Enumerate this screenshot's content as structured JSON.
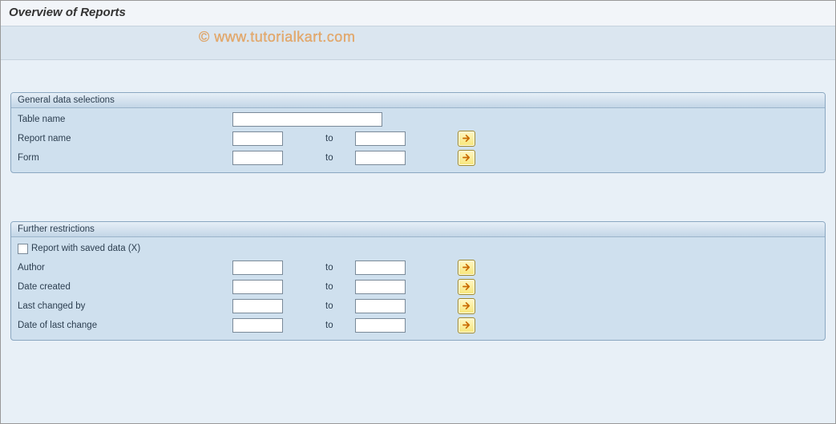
{
  "header": {
    "title": "Overview of Reports"
  },
  "watermark": "© www.tutorialkart.com",
  "groups": {
    "general": {
      "title": "General data selections",
      "table_name_label": "Table name",
      "table_name_value": "",
      "report_name_label": "Report name",
      "report_name_from": "",
      "report_name_to_label": "to",
      "report_name_to": "",
      "form_label": "Form",
      "form_from": "",
      "form_to_label": "to",
      "form_to": ""
    },
    "further": {
      "title": "Further restrictions",
      "saved_data_label": "Report with saved data (X)",
      "saved_data_checked": false,
      "author_label": "Author",
      "author_from": "",
      "author_to_label": "to",
      "author_to": "",
      "date_created_label": "Date created",
      "date_created_from": "",
      "date_created_to_label": "to",
      "date_created_to": "",
      "last_changed_by_label": "Last changed by",
      "last_changed_by_from": "",
      "last_changed_by_to_label": "to",
      "last_changed_by_to": "",
      "date_last_change_label": "Date of last change",
      "date_last_change_from": "",
      "date_last_change_to_label": "to",
      "date_last_change_to": ""
    }
  },
  "icons": {
    "arrow_color": "#d97a00"
  }
}
